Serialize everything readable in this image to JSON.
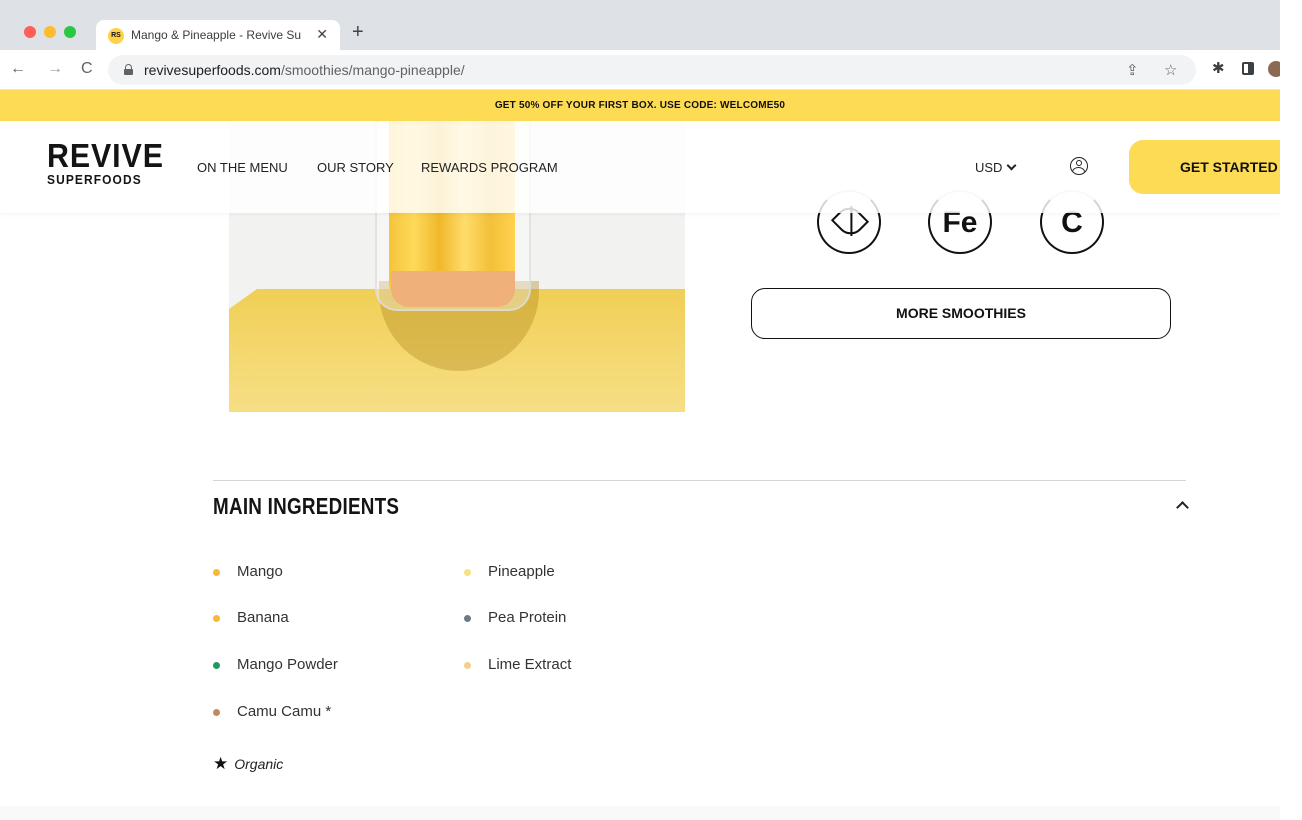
{
  "browser": {
    "tab_title": "Mango & Pineapple - Revive Su",
    "tab_favicon_text": "RS",
    "tab_close": "✕",
    "new_tab": "+",
    "url_domain": "revivesuperfoods.com",
    "url_path": "/smoothies/mango-pineapple/",
    "back": "←",
    "forward": "→",
    "reload": "C",
    "share_glyph": "⇪",
    "star_glyph": "☆",
    "extensions_glyph": "✱"
  },
  "promo": {
    "text": "GET 50% OFF YOUR FIRST BOX. USE CODE: WELCOME50"
  },
  "header": {
    "logo_main": "REVIVE",
    "logo_sub": "SUPERFOODS",
    "nav": [
      "ON THE MENU",
      "OUR STORY",
      "REWARDS PROGRAM"
    ],
    "currency": "USD",
    "cta": "GET STARTED"
  },
  "product": {
    "badges": {
      "iron": "Fe",
      "vitamin_c": "C"
    },
    "more_button": "MORE SMOOTHIES"
  },
  "ingredients": {
    "title": "MAIN INGREDIENTS",
    "items": [
      {
        "name": "Mango",
        "color": "#f5b93a"
      },
      {
        "name": "Pineapple",
        "color": "#f9e27e"
      },
      {
        "name": "Banana",
        "color": "#f5b93a"
      },
      {
        "name": "Pea Protein",
        "color": "#6e7b85"
      },
      {
        "name": "Mango Powder",
        "color": "#1e9b5a"
      },
      {
        "name": "Lime Extract",
        "color": "#f2cf8a"
      },
      {
        "name": "Camu Camu *",
        "color": "#c28a5c"
      }
    ],
    "organic_star": "★",
    "organic_label": "Organic"
  },
  "colors": {
    "brand_yellow": "#fddb55",
    "text_dark": "#141414"
  }
}
